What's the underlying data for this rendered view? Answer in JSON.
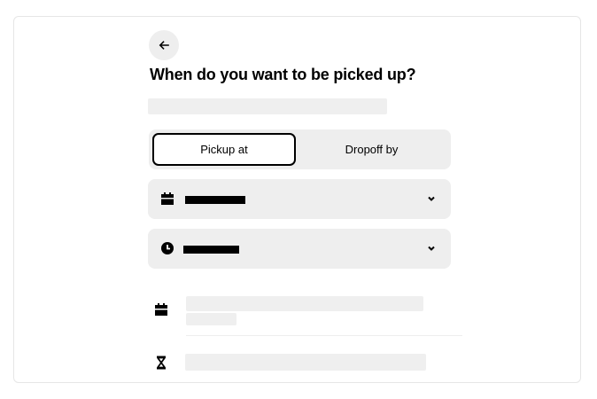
{
  "header": {
    "back_icon": "arrow-left-icon",
    "title": "When do you want to be picked up?"
  },
  "mode_toggle": {
    "options": [
      {
        "label": "Pickup at",
        "selected": true
      },
      {
        "label": "Dropoff by",
        "selected": false
      }
    ]
  },
  "date_select": {
    "icon": "calendar-icon",
    "value": "",
    "chevron_icon": "chevron-down-icon"
  },
  "time_select": {
    "icon": "clock-icon",
    "value": "",
    "chevron_icon": "chevron-down-icon"
  },
  "info_rows": [
    {
      "icon": "calendar-icon"
    },
    {
      "icon": "hourglass-icon"
    }
  ]
}
